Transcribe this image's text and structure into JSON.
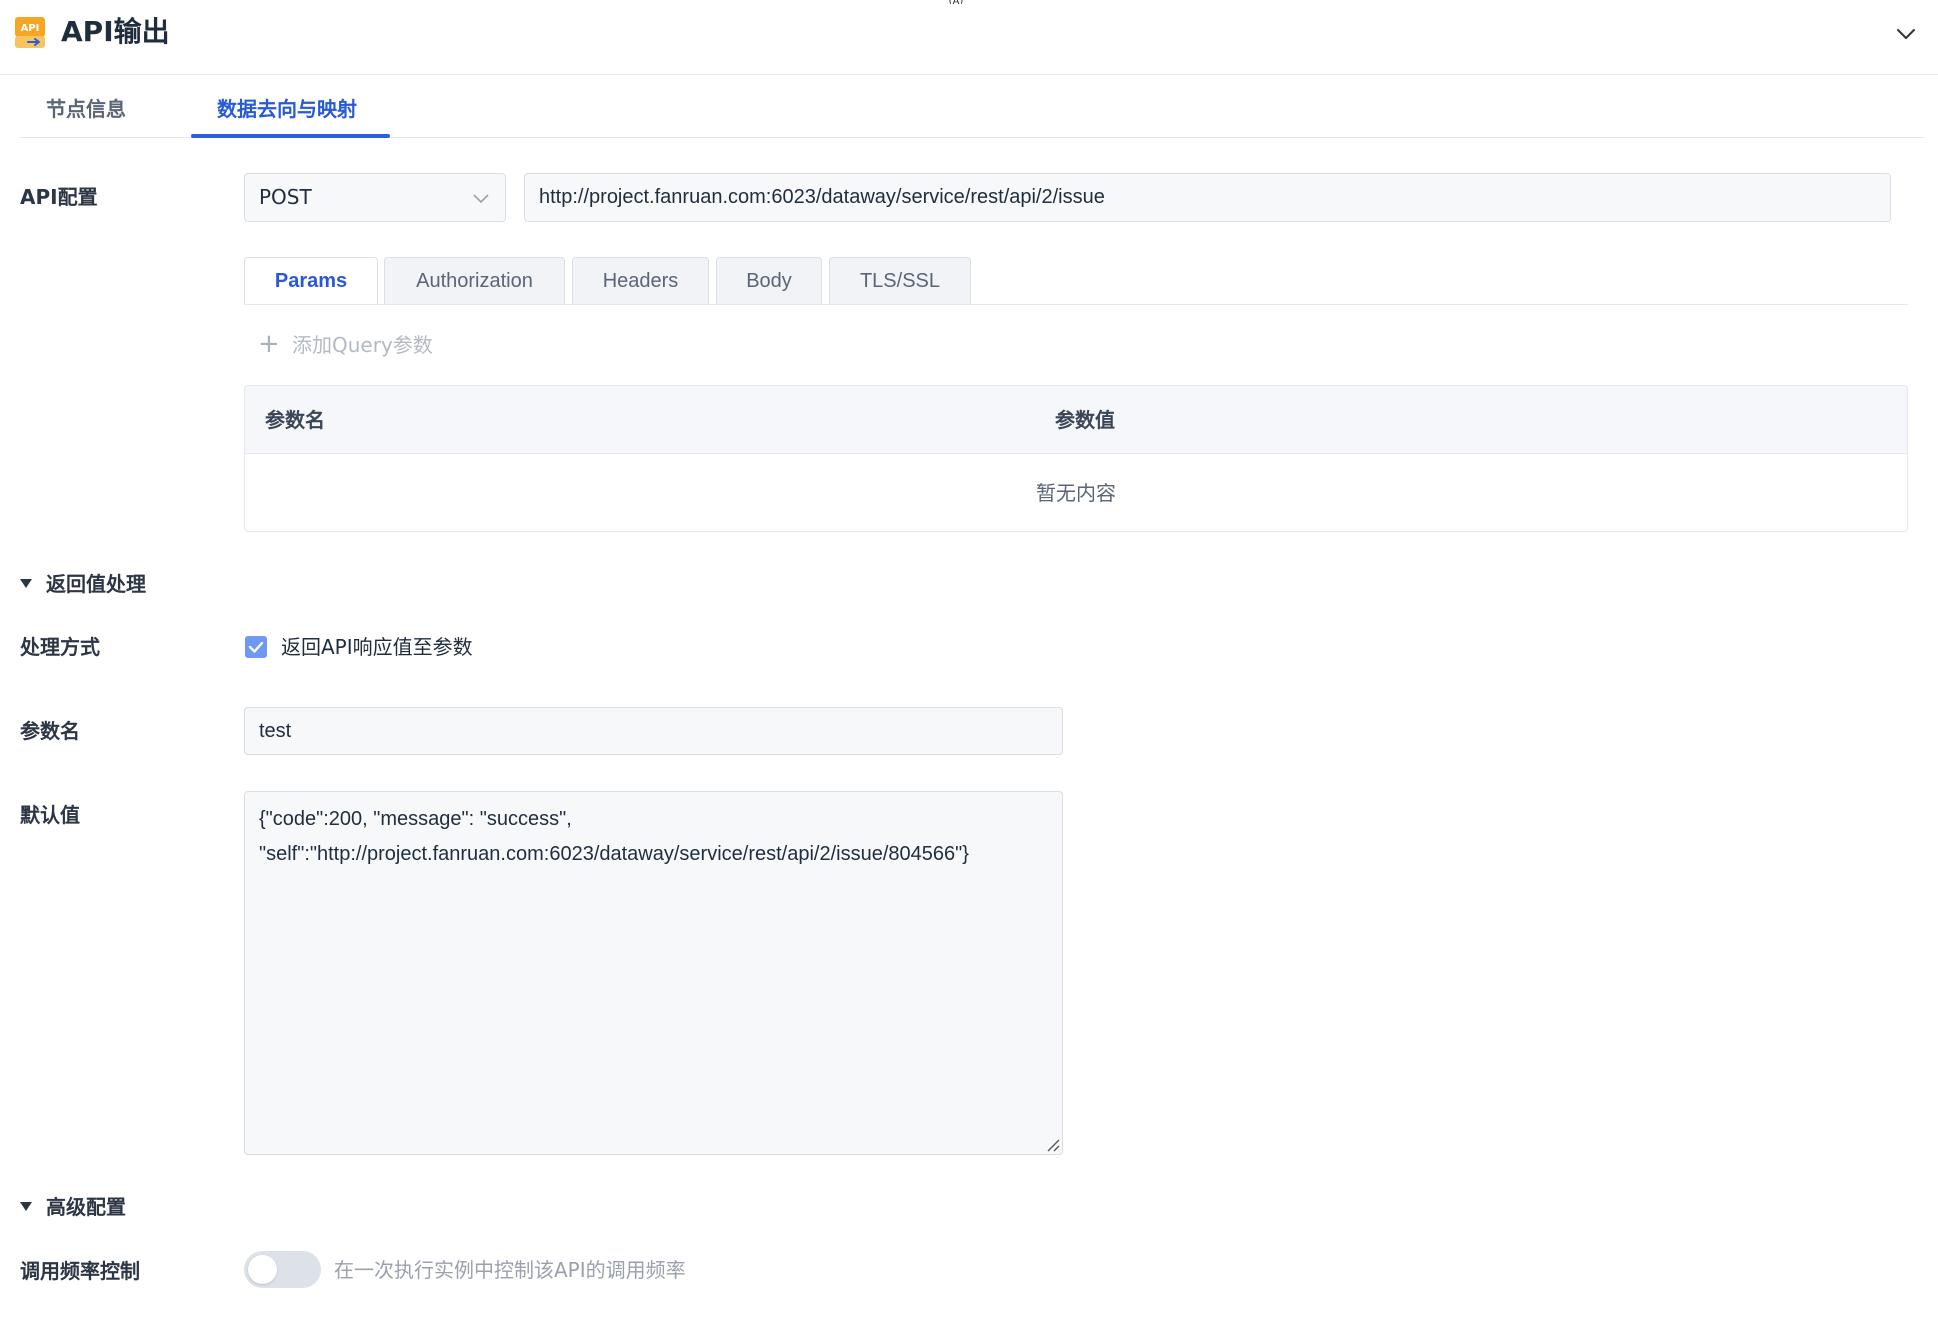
{
  "header": {
    "top_marker": "(A)",
    "logo_text": "API",
    "title": "API输出"
  },
  "tabs": [
    {
      "label": "节点信息",
      "active": false
    },
    {
      "label": "数据去向与映射",
      "active": true
    }
  ],
  "api_config": {
    "label": "API配置",
    "method": "POST",
    "url": "http://project.fanruan.com:6023/dataway/service/rest/api/2/issue",
    "sub_tabs": [
      {
        "label": "Params",
        "active": true
      },
      {
        "label": "Authorization",
        "active": false
      },
      {
        "label": "Headers",
        "active": false
      },
      {
        "label": "Body",
        "active": false
      },
      {
        "label": "TLS/SSL",
        "active": false
      }
    ],
    "add_query_label": "添加Query参数",
    "table": {
      "col_name": "参数名",
      "col_value": "参数值",
      "empty_text": "暂无内容"
    }
  },
  "return_section": {
    "title": "返回值处理",
    "method_label": "处理方式",
    "checkbox_label": "返回API响应值至参数",
    "checkbox_checked": true,
    "param_name_label": "参数名",
    "param_name_value": "test",
    "default_label": "默认值",
    "default_value": "{\"code\":200, \"message\": \"success\",\n\"self\":\"http://project.fanruan.com:6023/dataway/service/rest/api/2/issue/804566\"}"
  },
  "advanced_section": {
    "title": "高级配置",
    "rate_label": "调用频率控制",
    "rate_enabled": false,
    "rate_desc": "在一次执行实例中控制该API的调用频率"
  },
  "colors": {
    "accent": "#2859d6",
    "checkbox": "#6f98f2",
    "border": "#d9dee7"
  }
}
